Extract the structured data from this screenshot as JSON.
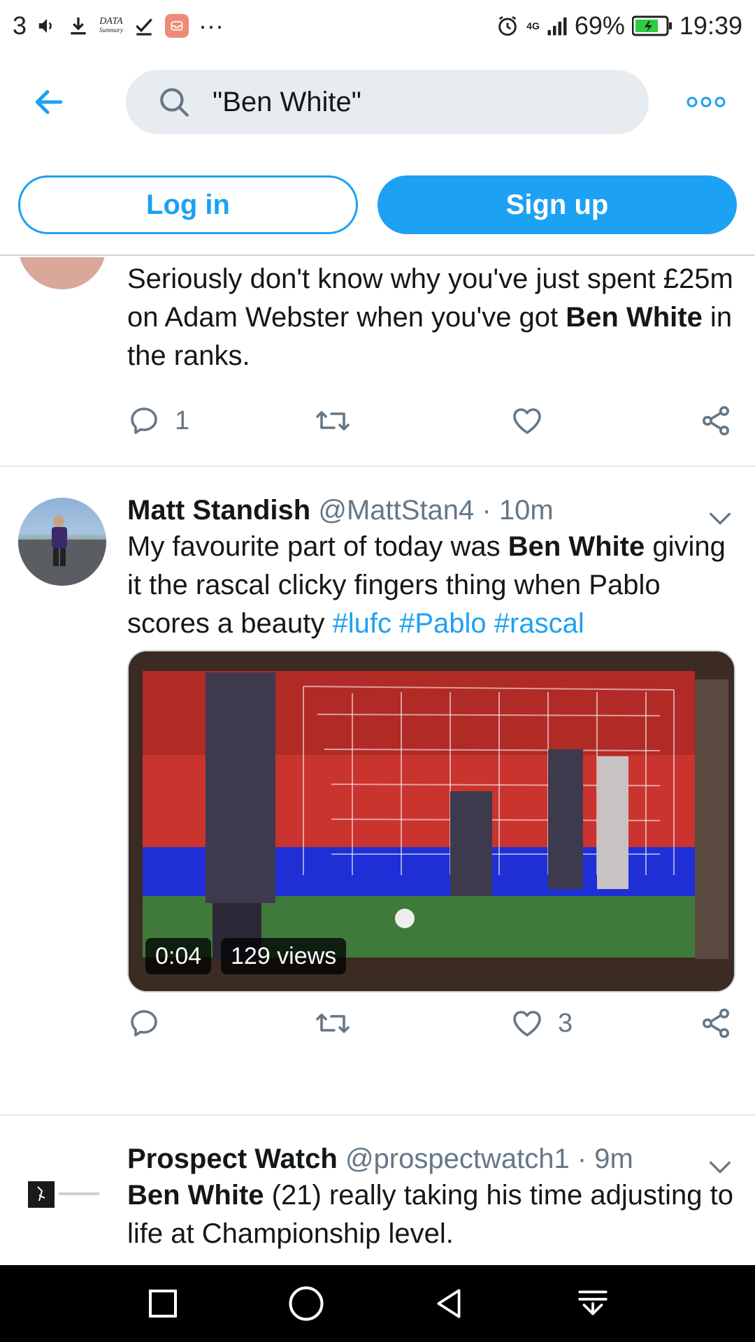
{
  "status_bar": {
    "sim": "3",
    "data_summary": "DATA",
    "data_summary_sub": "Summary",
    "more": "···",
    "network": "4G",
    "battery": "69%",
    "time": "19:39"
  },
  "search": {
    "query": "\"Ben White\""
  },
  "auth": {
    "login_label": "Log in",
    "signup_label": "Sign up"
  },
  "tweets": [
    {
      "text_part1": "Seriously don't know why you've just spent £25m on Adam Webster when you've got ",
      "text_bold1": "Ben White",
      "text_part2": " in the ranks.",
      "reply_count": "1",
      "like_count": ""
    },
    {
      "name": "Matt Standish",
      "handle": "@MattStan4",
      "time": "10m",
      "text_part1": "My favourite part of today was ",
      "text_bold1": "Ben White",
      "text_part2": " giving it the rascal clicky fingers thing when Pablo scores a beauty ",
      "hashtags": [
        "#lufc",
        "#Pablo",
        "#rascal"
      ],
      "video_duration": "0:04",
      "video_views": "129 views",
      "reply_count": "",
      "like_count": "3"
    },
    {
      "name": "Prospect Watch",
      "handle": "@prospectwatch1",
      "time": "9m",
      "text_bold1": "Ben White",
      "text_part1": " (21) really taking his time adjusting to life at Championship level."
    }
  ],
  "colors": {
    "accent": "#1da1f2",
    "text": "#14171a",
    "secondary": "#657786",
    "divider": "#e1e8ed",
    "search_bg": "#e6ecf0"
  },
  "icons": {
    "back": "arrow-left-icon",
    "search": "search-icon",
    "more": "more-icon",
    "reply": "reply-icon",
    "retweet": "retweet-icon",
    "like": "heart-icon",
    "share": "share-icon",
    "caret": "chevron-down-icon"
  }
}
